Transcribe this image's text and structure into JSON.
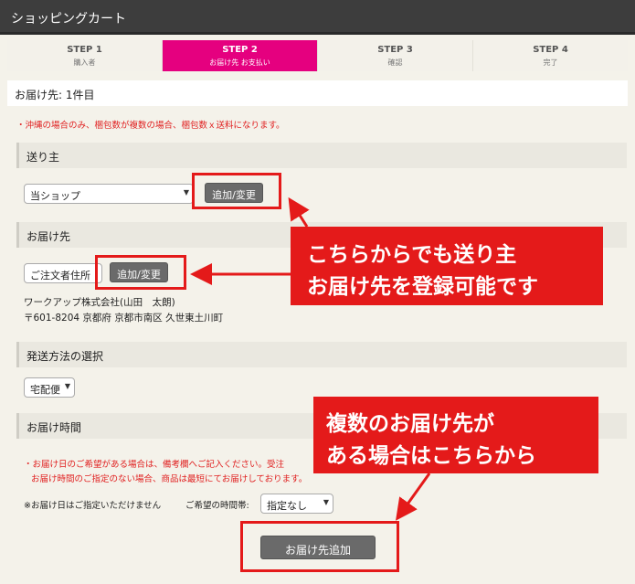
{
  "title": "ショッピングカート",
  "steps": [
    {
      "label": "STEP 1",
      "sub": "購入者"
    },
    {
      "label": "STEP 2",
      "sub": "お届け先 お支払い"
    },
    {
      "label": "STEP 3",
      "sub": "確認"
    },
    {
      "label": "STEP 4",
      "sub": "完了"
    }
  ],
  "destination_header": "お届け先: 1件目",
  "okinawa_note": "・沖縄の場合のみ、梱包数が複数の場合、梱包数ｘ送料になります。",
  "sender": {
    "section": "送り主",
    "select_value": "当ショップ",
    "button": "追加/変更"
  },
  "recipient": {
    "section": "お届け先",
    "select_value": "ご注文者住所",
    "button": "追加/変更",
    "name": "ワークアップ株式会社(山田　太朗)",
    "address": "〒601-8204 京都府 京都市南区 久世東土川町"
  },
  "shipping": {
    "section": "発送方法の選択",
    "select_value": "宅配便"
  },
  "delivery_time": {
    "section": "お届け時間",
    "note1": "・お届け日のご希望がある場合は、備考欄へご記入ください。受注",
    "note2": "お届け時間のご指定のない場合、商品は最短にてお届けしております。",
    "date_text": "※お届け日はご指定いただけません",
    "time_label": "ご希望の時間帯:",
    "time_value": "指定なし"
  },
  "add_destination_button": "お届け先追加",
  "callout1": {
    "line1": "こちらからでも送り主",
    "line2": "お届け先を登録可能です"
  },
  "callout2": {
    "line1": "複数のお届け先が",
    "line2": "ある場合はこちらから"
  },
  "colors": {
    "accent": "#e5007f",
    "callout": "#e41a1a"
  }
}
